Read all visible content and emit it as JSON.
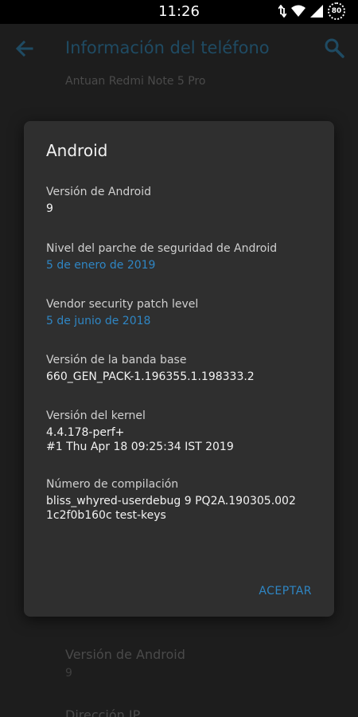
{
  "status_bar": {
    "time": "11:26",
    "battery": "80"
  },
  "app_bar": {
    "title": "Información del teléfono",
    "subtitle": "Antuan Redmi Note 5 Pro"
  },
  "background_list": [
    {
      "title": "Versión de Android",
      "value": "9"
    },
    {
      "title": "Dirección IP",
      "value": ""
    }
  ],
  "dialog": {
    "title": "Android",
    "items": [
      {
        "label": "Versión de Android",
        "value": "9",
        "link": false
      },
      {
        "label": "Nivel del parche de seguridad de Android",
        "value": "5 de enero de 2019",
        "link": true
      },
      {
        "label": "Vendor security patch level",
        "value": "5 de junio de 2018",
        "link": true
      },
      {
        "label": "Versión de la banda base",
        "value": "660_GEN_PACK-1.196355.1.198333.2",
        "link": false
      },
      {
        "label": "Versión del kernel",
        "value": "4.4.178-perf+\n#1 Thu Apr 18 09:25:34 IST 2019",
        "link": false
      },
      {
        "label": "Número de compilación",
        "value": "bliss_whyred-userdebug 9 PQ2A.190305.002\n1c2f0b160c test-keys",
        "link": false
      }
    ],
    "accept_label": "ACEPTAR"
  },
  "colors": {
    "accent": "#2f86c4",
    "dialog_bg": "#2f2f2f",
    "screen_bg": "#1d1d1d"
  },
  "icons": [
    "back-arrow-icon",
    "search-icon",
    "wifi-icon",
    "signal-icon",
    "data-sync-icon",
    "battery-icon"
  ]
}
